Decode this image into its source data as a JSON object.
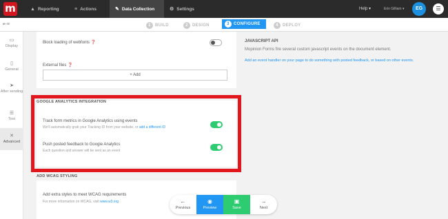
{
  "topbar": {
    "logo_letter": "m",
    "nav": [
      {
        "icon": "chart-icon",
        "glyph": "▲",
        "label": "Reporting"
      },
      {
        "icon": "actions-icon",
        "glyph": "≡",
        "label": "Actions"
      },
      {
        "icon": "wrench-icon",
        "glyph": "✎",
        "label": "Data Collection"
      },
      {
        "icon": "gear-icon",
        "glyph": "⚙",
        "label": "Settings"
      }
    ],
    "help_label": "Help ▾",
    "user_name": "Erin Gilliam ▾",
    "avatar_initials": "EG"
  },
  "steps": [
    {
      "num": "1",
      "label": "BUILD"
    },
    {
      "num": "2",
      "label": "DESIGN"
    },
    {
      "num": "3",
      "label": "CONFIGURE"
    },
    {
      "num": "4",
      "label": "DEPLOY"
    }
  ],
  "sidebar": [
    {
      "icon": "monitor-icon",
      "glyph": "▭",
      "label": "Display"
    },
    {
      "icon": "document-icon",
      "glyph": "▯",
      "label": "General"
    },
    {
      "icon": "send-icon",
      "glyph": "➤",
      "label": "After sending"
    },
    {
      "icon": "text-icon",
      "glyph": "☰",
      "label": "Text"
    },
    {
      "icon": "tools-icon",
      "glyph": "✕",
      "label": "Advanced"
    }
  ],
  "settings": {
    "block_webfonts_label": "Block loading of webfonts",
    "external_files_label": "External files",
    "add_label": "+ Add",
    "ga_section": "GOOGLE ANALYTICS INTEGRATION",
    "ga_track_label": "Track form metrics in Google Analytics using events",
    "ga_track_sub": "We'll automatically grab your Tracking ID from your website, or",
    "ga_track_link": "add a different ID",
    "ga_push_label": "Push posted feedback to Google Analytics",
    "ga_push_sub": "Each question and answer will be sent as an event",
    "wcag_section": "ADD WCAG STYLING",
    "wcag_label": "Add extra styles to meet WCAG requirements",
    "wcag_sub": "For more information on WCAG, visit",
    "wcag_link": "www.w3.org"
  },
  "toggles": {
    "block_webfonts": "off",
    "ga_track": "on",
    "ga_push": "on"
  },
  "js_api": {
    "heading": "JAVASCRIPT API",
    "text": "Mopinion Forms fire several custom javascript events on the document element.",
    "link": "Add an event handler on your page to do something with posted feedback, or based on other events."
  },
  "actions": [
    {
      "icon": "arrow-left-icon",
      "glyph": "←",
      "label": "Previous"
    },
    {
      "icon": "eye-icon",
      "glyph": "◉",
      "label": "Preview"
    },
    {
      "icon": "save-icon",
      "glyph": "▣",
      "label": "Save"
    },
    {
      "icon": "arrow-right-icon",
      "glyph": "→",
      "label": "Next"
    }
  ],
  "colors": {
    "brand": "#d4171e",
    "accent": "#2196f3",
    "toggle_on": "#2ecc71",
    "highlight": "#e2161d"
  }
}
